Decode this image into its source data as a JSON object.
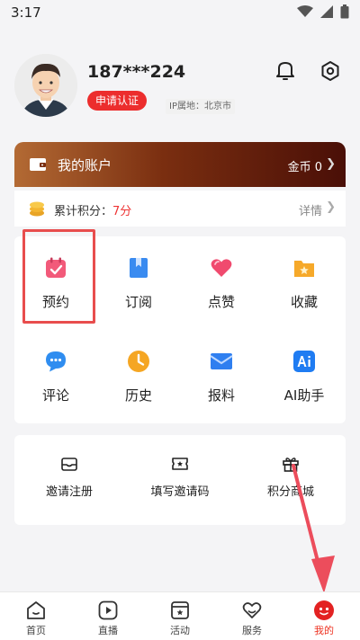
{
  "status_bar": {
    "time": "3:17"
  },
  "profile": {
    "phone": "187***224",
    "cert_label": "申请认证",
    "ip_location": "IP属地：北京市"
  },
  "account": {
    "title": "我的账户",
    "coins_label": "金币 0",
    "points_label": "累计积分：",
    "points_value": "7分",
    "detail_label": "详情"
  },
  "features": [
    {
      "label": "预约",
      "icon": "calendar-check-icon"
    },
    {
      "label": "订阅",
      "icon": "book-bookmark-icon"
    },
    {
      "label": "点赞",
      "icon": "heart-icon"
    },
    {
      "label": "收藏",
      "icon": "folder-star-icon"
    },
    {
      "label": "评论",
      "icon": "comment-bubble-icon"
    },
    {
      "label": "历史",
      "icon": "clock-icon"
    },
    {
      "label": "报料",
      "icon": "mail-icon"
    },
    {
      "label": "AI助手",
      "icon": "ai-icon"
    }
  ],
  "invite": [
    {
      "label": "邀请注册",
      "icon": "envelope-icon"
    },
    {
      "label": "填写邀请码",
      "icon": "ticket-star-icon"
    },
    {
      "label": "积分商城",
      "icon": "gift-icon"
    }
  ],
  "tabs": [
    {
      "label": "首页",
      "icon": "home-icon",
      "active": false
    },
    {
      "label": "直播",
      "icon": "play-icon",
      "active": false
    },
    {
      "label": "活动",
      "icon": "activity-icon",
      "active": false
    },
    {
      "label": "服务",
      "icon": "service-heart-icon",
      "active": false
    },
    {
      "label": "我的",
      "icon": "profile-dots-icon",
      "active": true
    }
  ],
  "colors": {
    "accent_red": "#e32222",
    "account_gradient_start": "#b36a34",
    "account_gradient_end": "#4a0f07",
    "highlight": "#e84d4d"
  }
}
